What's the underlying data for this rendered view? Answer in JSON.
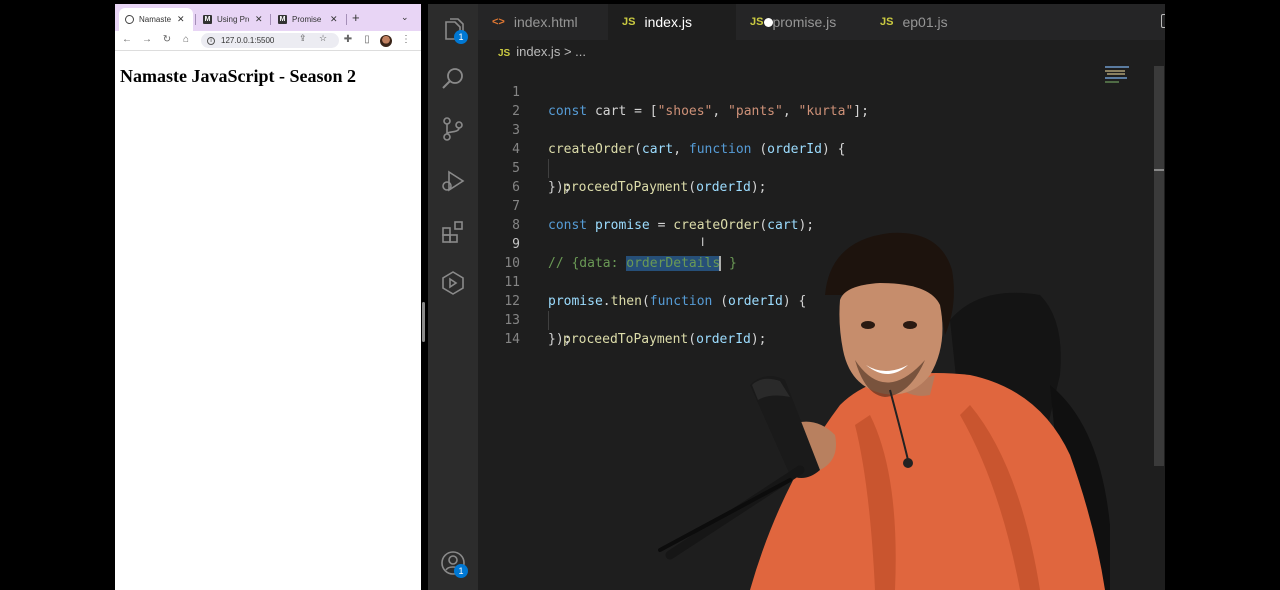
{
  "browser": {
    "tabs": [
      {
        "title": "Namaste",
        "favicon": "globe-icon",
        "active": true
      },
      {
        "title": "Using Pro",
        "favicon": "mdn-icon",
        "active": false
      },
      {
        "title": "Promise",
        "favicon": "mdn-icon",
        "active": false
      }
    ],
    "url": "127.0.0.1:5500",
    "heading": "Namaste JavaScript - Season 2"
  },
  "editor": {
    "tabs": [
      {
        "label": "index.html",
        "icon": "<>",
        "active": false
      },
      {
        "label": "index.js",
        "icon": "JS",
        "active": true,
        "modified": true
      },
      {
        "label": "promise.js",
        "icon": "JS",
        "active": false
      },
      {
        "label": "ep01.js",
        "icon": "JS",
        "active": false
      }
    ],
    "breadcrumb": {
      "icon": "JS",
      "file": "index.js",
      "rest": "> ..."
    },
    "badges": {
      "explorer": "1",
      "accounts": "1"
    },
    "line_numbers": [
      "1",
      "2",
      "3",
      "4",
      "5",
      "6",
      "7",
      "8",
      "9",
      "10",
      "11",
      "12",
      "13",
      "14"
    ],
    "code": {
      "l1": [
        "const",
        " cart = [",
        "\"shoes\"",
        ", ",
        "\"pants\"",
        ", ",
        "\"kurta\"",
        "];"
      ],
      "l3": [
        "createOrder",
        "(",
        "cart",
        ", ",
        "function",
        " (",
        "orderId",
        ") {"
      ],
      "l4": [
        "proceedToPayment",
        "(",
        "orderId",
        ");"
      ],
      "l5": "});",
      "l7": [
        "const",
        " ",
        "promise",
        " = ",
        "createOrder",
        "(",
        "cart",
        ");"
      ],
      "l9": [
        "// {data: ",
        "orderDetails",
        " }"
      ],
      "l11": [
        "promise",
        ".",
        "then",
        "(",
        "function",
        " (",
        "orderId",
        ") {"
      ],
      "l12": [
        "proceedToPayment",
        "(",
        "orderId",
        ");"
      ],
      "l13": "});"
    }
  },
  "colors": {
    "keyword": "#569cd6",
    "function": "#dcdcaa",
    "variable": "#9cdcfe",
    "string": "#ce9178",
    "comment": "#6a9955",
    "browser_tabstrip": "#e8d5f5"
  }
}
